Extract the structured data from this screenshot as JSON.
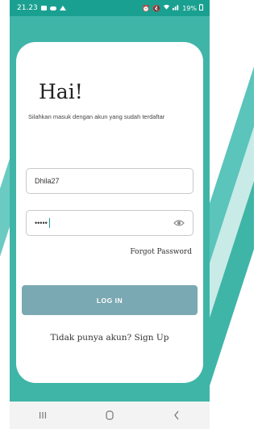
{
  "colors": {
    "accent": "#3fb5a8",
    "status_bar": "#1aa091",
    "button": "#7ba9b3"
  },
  "status_bar": {
    "time": "21.23",
    "battery": "19%"
  },
  "login": {
    "title": "Hai!",
    "subtitle": "Silahkan masuk dengan akun yang sudah terdaftar",
    "username_value": "Dhila27",
    "password_masked": "•••••",
    "forgot_password": "Forgot Password",
    "login_button": "LOG IN",
    "signup_text": "Tidak punya akun? Sign Up"
  },
  "nav": {
    "icons": [
      "recent-apps-icon",
      "home-icon",
      "back-icon"
    ]
  }
}
